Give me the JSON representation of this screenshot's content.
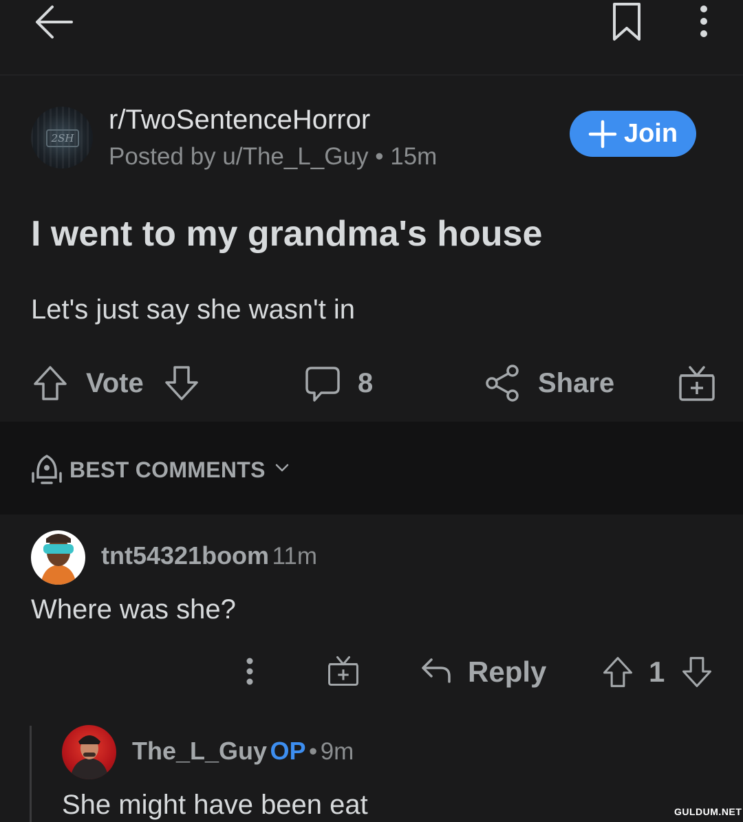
{
  "topbar": {
    "back_icon": "arrow-left-icon",
    "save_icon": "bookmark-icon",
    "more_icon": "more-vertical-icon"
  },
  "post": {
    "subreddit_avatar_text": "2SH",
    "subreddit": "r/TwoSentenceHorror",
    "posted_by": "Posted by u/The_L_Guy",
    "separator": "•",
    "age": "15m",
    "join_label": "Join",
    "title": "I went to my grandma's house",
    "body": "Let's just say she wasn't in",
    "actions": {
      "vote_label": "Vote",
      "comment_count": "8",
      "share_label": "Share"
    }
  },
  "sort": {
    "label": "BEST COMMENTS"
  },
  "comments": [
    {
      "username": "tnt54321boom",
      "age": "11m",
      "text": "Where was she?",
      "reply_label": "Reply",
      "score": "1"
    },
    {
      "username": "The_L_Guy",
      "op_label": "OP",
      "separator": "•",
      "age": "9m",
      "text": "She might have been eat"
    }
  ],
  "watermark": "GULDUM.NET",
  "colors": {
    "background": "#1a1a1b",
    "sort_bar": "#121213",
    "accent_blue": "#3d8ef0",
    "text_primary": "#d7dadc",
    "text_muted": "#8b8e90"
  }
}
